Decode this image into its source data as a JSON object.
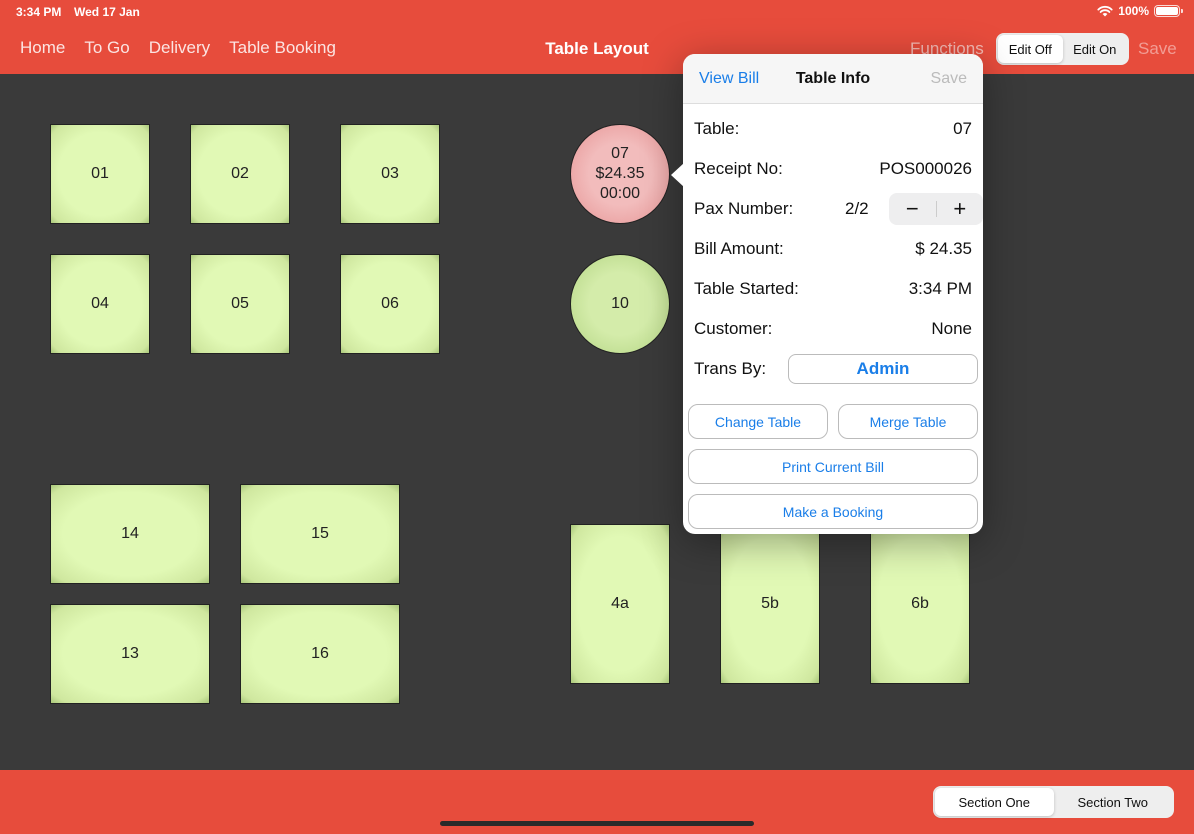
{
  "status": {
    "time": "3:34 PM",
    "date": "Wed 17 Jan",
    "battery": "100%",
    "battery_level": 1.0,
    "wifi_icon": "wifi-icon"
  },
  "nav": {
    "links": [
      "Home",
      "To Go",
      "Delivery",
      "Table Booking"
    ],
    "title": "Table Layout",
    "functions": "Functions",
    "edit_segments": [
      {
        "label": "Edit Off",
        "active": true
      },
      {
        "label": "Edit On",
        "active": false
      }
    ],
    "save": "Save"
  },
  "tables": [
    {
      "id": "01",
      "shape": "square"
    },
    {
      "id": "02",
      "shape": "square"
    },
    {
      "id": "03",
      "shape": "square"
    },
    {
      "id": "04",
      "shape": "square"
    },
    {
      "id": "05",
      "shape": "square"
    },
    {
      "id": "06",
      "shape": "square"
    },
    {
      "id": "07",
      "shape": "round",
      "status": "occupied",
      "amount": "$24.35",
      "elapsed": "00:00"
    },
    {
      "id": "10",
      "shape": "round",
      "status": "free"
    },
    {
      "id": "14",
      "shape": "rect"
    },
    {
      "id": "15",
      "shape": "rect"
    },
    {
      "id": "13",
      "shape": "rect"
    },
    {
      "id": "16",
      "shape": "rect"
    },
    {
      "id": "4a",
      "shape": "tall"
    },
    {
      "id": "5b",
      "shape": "tall"
    },
    {
      "id": "6b",
      "shape": "tall"
    }
  ],
  "popover": {
    "view_bill": "View Bill",
    "title": "Table Info",
    "save": "Save",
    "fields": {
      "table": {
        "label": "Table:",
        "value": "07"
      },
      "receipt": {
        "label": "Receipt No:",
        "value": "POS000026"
      },
      "pax": {
        "label": "Pax Number:",
        "value": "2/2",
        "minus": "−",
        "plus": "+"
      },
      "bill": {
        "label": "Bill Amount:",
        "value": "$ 24.35"
      },
      "started": {
        "label": "Table Started:",
        "value": "3:34 PM"
      },
      "customer": {
        "label": "Customer:",
        "value": "None"
      },
      "trans_by": {
        "label": "Trans By:",
        "value": "Admin"
      }
    },
    "buttons": {
      "change_table": "Change Table",
      "merge_table": "Merge Table",
      "print_bill": "Print Current Bill",
      "make_booking": "Make a Booking"
    }
  },
  "bottom": {
    "section_segments": [
      {
        "label": "Section One",
        "active": true
      },
      {
        "label": "Section Two",
        "active": false
      }
    ]
  },
  "colors": {
    "accent": "#e74c3c",
    "link": "#1a7ee8",
    "table_free": "#e1f9b5",
    "table_occupied": "#f2bcbc",
    "floor": "#3a3a3a"
  }
}
